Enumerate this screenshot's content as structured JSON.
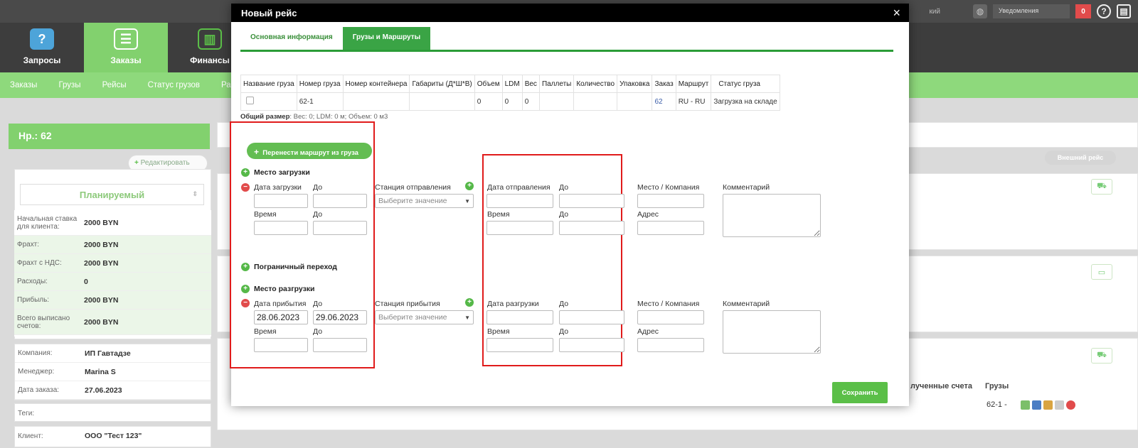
{
  "topbar": {
    "partial_text": "кий",
    "notifications_label": "Уведомления",
    "notifications_count": "0",
    "help_icon": "?"
  },
  "mainnav": [
    {
      "label": "Запросы",
      "icon": "question-bubbles-icon"
    },
    {
      "label": "Заказы",
      "icon": "orders-icon",
      "active": true
    },
    {
      "label": "Финансы",
      "icon": "chart-presentation-icon"
    }
  ],
  "subnav": [
    "Заказы",
    "Грузы",
    "Рейсы",
    "Статус грузов",
    "Ра"
  ],
  "left": {
    "nr_title": "Нр.: 62",
    "edit_button": "Редактировать",
    "status": "Планируемый",
    "finance": [
      {
        "label": "Начальная ставка для клиента:",
        "value": "2000 BYN"
      },
      {
        "label": "Фрахт:",
        "value": "2000 BYN"
      },
      {
        "label": "Фрахт с НДС:",
        "value": "2000 BYN"
      },
      {
        "label": "Расходы:",
        "value": "0"
      },
      {
        "label": "Прибыль:",
        "value": "2000 BYN"
      },
      {
        "label": "Всего выписано счетов:",
        "value": "2000 BYN"
      }
    ],
    "details": [
      {
        "label": "Компания:",
        "value": "ИП Гавтадзе"
      },
      {
        "label": "Менеджер:",
        "value": "Marina S"
      },
      {
        "label": "Дата заказа:",
        "value": "27.06.2023"
      }
    ],
    "tags_label": "Теги:",
    "client_label": "Клиент:",
    "client_value": "ООО \"Тест 123\""
  },
  "right": {
    "external_trip_button": "Внешний рейс",
    "received_invoices_header": "лученные счета",
    "cargo_header": "Грузы",
    "cargo_cell": "62-1 -"
  },
  "modal": {
    "title": "Новый рейс",
    "close": "×",
    "tabs": [
      "Основная информация",
      "Грузы и Маршруты"
    ],
    "active_tab": 1,
    "table": {
      "headers": [
        "Название груза",
        "Номер груза",
        "Номер контейнера",
        "Габариты (Д*Ш*В)",
        "Объем",
        "LDM",
        "Вес",
        "Паллеты",
        "Количество",
        "Упаковка",
        "Заказ",
        "Маршрут",
        "Статус груза"
      ],
      "row": [
        "",
        "62-1",
        "",
        "",
        "0",
        "0",
        "0",
        "",
        "",
        "",
        "62",
        "RU - RU",
        "Загрузка на складе"
      ]
    },
    "size_line": {
      "label": "Общий размер",
      "text": ": Вес: 0;  LDM: 0 м;  Объем: 0 м3"
    },
    "transfer_route_button": "Перенести маршрут из груза",
    "loading": {
      "title": "Место загрузки",
      "date_label": "Дата загрузки",
      "to_label": "До",
      "time_label": "Время",
      "time_to_label": "До",
      "station_label": "Станция отправления",
      "station_placeholder": "Выберите значение",
      "dep_date_label": "Дата отправления",
      "dep_to_label": "До",
      "dep_time_label": "Время",
      "dep_time_to_label": "До",
      "place_label": "Место / Компания",
      "address_label": "Адрес",
      "comment_label": "Комментарий"
    },
    "border_title": "Пограничный переход",
    "unloading": {
      "title": "Место разгрузки",
      "date_label": "Дата прибытия",
      "to_label": "До",
      "date_value": "28.06.2023",
      "to_value": "29.06.2023",
      "time_label": "Время",
      "time_to_label": "До",
      "station_label": "Станция прибытия",
      "station_placeholder": "Выберите значение",
      "unl_date_label": "Дата разгрузки",
      "unl_to_label": "До",
      "unl_time_label": "Время",
      "unl_time_to_label": "До",
      "place_label": "Место / Компания",
      "address_label": "Адрес",
      "comment_label": "Комментарий"
    },
    "save_button": "Сохранить"
  }
}
